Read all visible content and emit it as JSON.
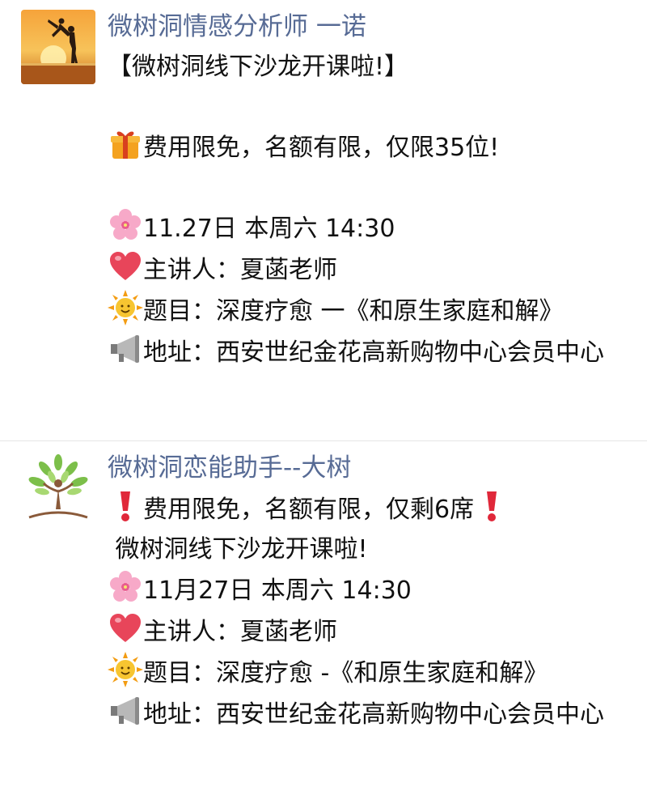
{
  "posts": [
    {
      "author": "微树洞情感分析师  一诺",
      "avatar_icon": "sunset-couple-avatar",
      "lines": [
        {
          "icon": "",
          "text": "【微树洞线下沙龙开课啦!】"
        },
        {
          "icon": "",
          "text": ""
        },
        {
          "icon": "gift-icon",
          "text": "费用限免，名额有限，仅限35位!"
        },
        {
          "icon": "",
          "text": ""
        },
        {
          "icon": "cherry-blossom-icon",
          "text": "11.27日 本周六 14:30"
        },
        {
          "icon": "heart-icon",
          "text": "主讲人：夏菡老师"
        },
        {
          "icon": "sun-face-icon",
          "text": "题目：深度疗愈 一《和原生家庭和解》"
        },
        {
          "icon": "loudspeaker-icon",
          "text": "地址：西安世纪金花高新购物中心会员中心"
        }
      ]
    },
    {
      "author": "微树洞恋能助手--大树",
      "avatar_icon": "tree-person-avatar",
      "lines": [
        {
          "icon": "exclamation-icon",
          "text": "费用限免，名额有限，仅剩6席",
          "icon_end": "exclamation-icon"
        },
        {
          "icon": "",
          "text": " 微树洞线下沙龙开课啦!"
        },
        {
          "icon": "cherry-blossom-icon",
          "text": "11月27日 本周六 14:30"
        },
        {
          "icon": "heart-icon",
          "text": "主讲人：夏菡老师"
        },
        {
          "icon": "sun-face-icon",
          "text": "题目：深度疗愈 -《和原生家庭和解》"
        },
        {
          "icon": "loudspeaker-icon",
          "text": "地址：西安世纪金花高新购物中心会员中心"
        }
      ]
    }
  ],
  "colors": {
    "author": "#576b95",
    "text": "#111111",
    "divider": "#e6e6e6"
  }
}
